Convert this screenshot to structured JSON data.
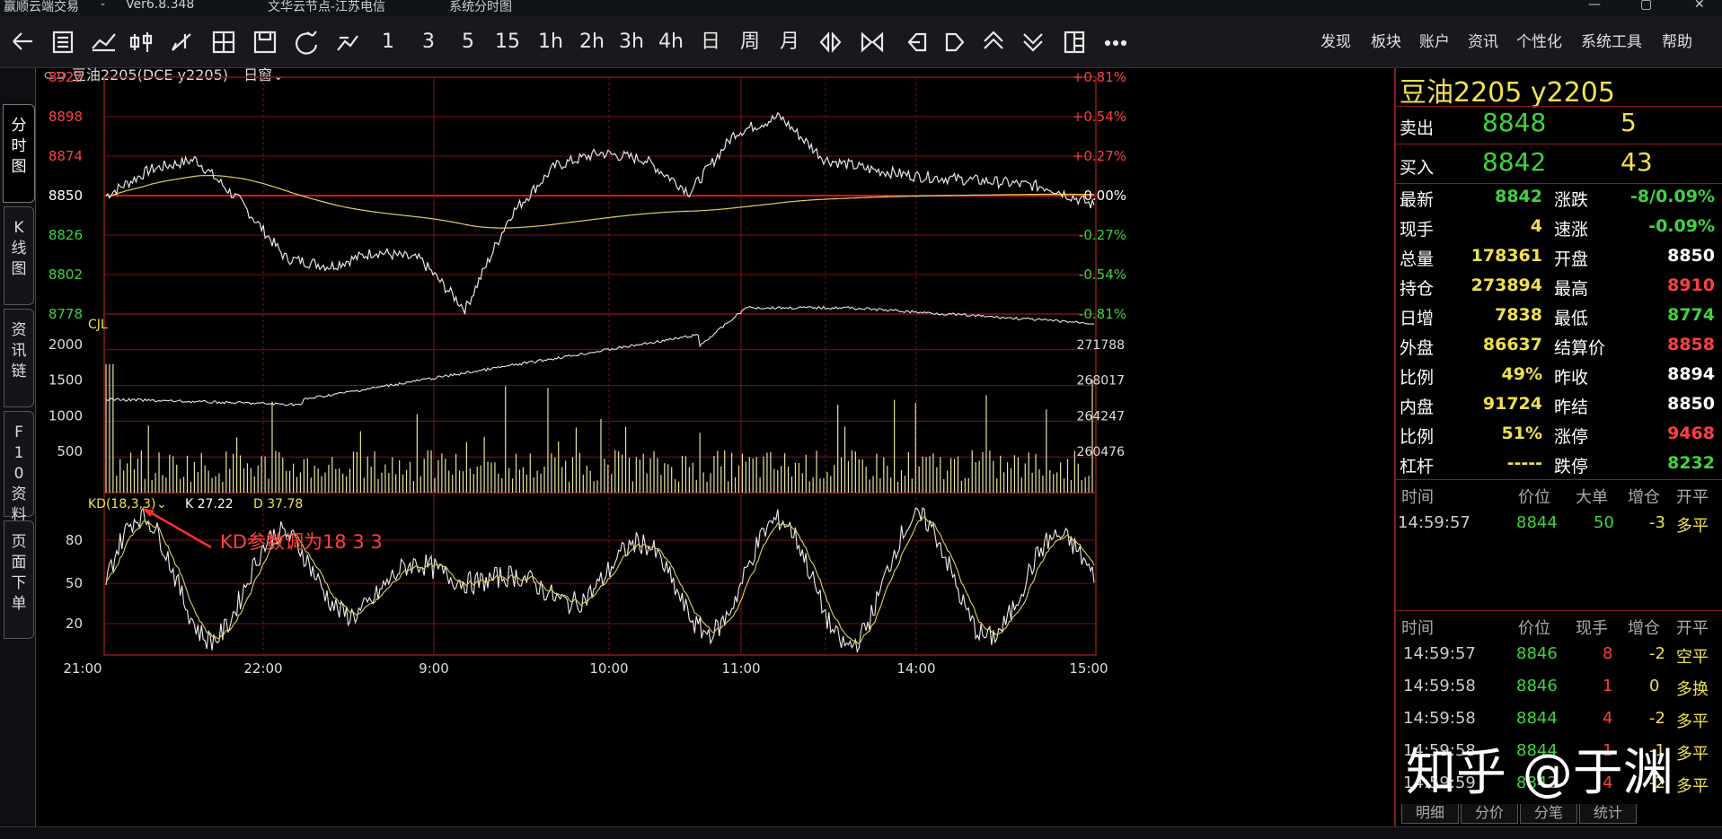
{
  "window": {
    "title_items": [
      "赢顺云端交易",
      "-",
      "Ver6.8.348",
      "文华云节点-江苏电信",
      "系统分时图"
    ]
  },
  "toolbar": {
    "icons": [
      "back-icon",
      "list-icon",
      "line-chart-icon",
      "candlestick-icon",
      "draw-icon",
      "grid-icon",
      "save-icon",
      "refresh-icon",
      "analysis-icon"
    ],
    "periods": [
      "1",
      "3",
      "5",
      "15",
      "1h",
      "2h",
      "3h",
      "4h",
      "日",
      "周",
      "月"
    ],
    "nav_icons": [
      "expand-icon",
      "shrink-icon",
      "arrow-left-icon",
      "arrow-right-icon",
      "arrow-up-icon",
      "arrow-down-icon",
      "layout-icon",
      "more-icon"
    ],
    "menu": [
      "发现",
      "板块",
      "账户",
      "资讯",
      "个性化",
      "系统工具",
      "帮助"
    ]
  },
  "sidebar": {
    "tabs": [
      "分时图",
      "K线图",
      "资讯链",
      "F10资料",
      "页面下单"
    ]
  },
  "chart": {
    "header": {
      "symbol": "豆油2205(DCE y2205)",
      "window": "日窗"
    },
    "price_axis_left": [
      "8922",
      "8898",
      "8874",
      "8850",
      "8826",
      "8802",
      "8778"
    ],
    "price_axis_right": [
      "+0.81%",
      "+0.54%",
      "+0.27%",
      "0.00%",
      "-0.27%",
      "-0.54%",
      "-0.81%"
    ],
    "volume_label": "CJL",
    "volume_axis_left": [
      "2000",
      "1500",
      "1000",
      "500"
    ],
    "volume_axis_right": [
      "271788",
      "268017",
      "264247",
      "260476"
    ],
    "kd_label": "KD(18,3,3)",
    "kd_k": "K 27.22",
    "kd_d": "D 37.78",
    "kd_axis": [
      "80",
      "50",
      "20"
    ],
    "annotation": "KD参数调为18  3  3",
    "time_axis": [
      "21:00",
      "22:00",
      "9:00",
      "10:00",
      "11:00",
      "14:00",
      "15:00"
    ]
  },
  "chart_data": [
    {
      "type": "line",
      "title": "",
      "series_price": "white",
      "series_avg": "yellow",
      "ylim": [
        8778,
        8922
      ],
      "x": [
        "21:00",
        "22:00",
        "9:00",
        "10:00",
        "11:00",
        "14:00",
        "15:00"
      ],
      "values": [
        8850,
        8866,
        8872,
        8846,
        8812,
        8807,
        8816,
        8811,
        8781,
        8838,
        8868,
        8876,
        8872,
        8852,
        8888,
        8898,
        8872,
        8866,
        8862,
        8860,
        8858,
        8855,
        8844
      ]
    },
    {
      "type": "bar",
      "title": "",
      "ylabel": "CJL",
      "ylim": [
        0,
        2500
      ],
      "note": "volume bars with open interest line"
    },
    {
      "type": "line",
      "title": "",
      "series": [
        {
          "name": "K",
          "last": 27.22
        },
        {
          "name": "D",
          "last": 37.78
        }
      ],
      "ylim": [
        0,
        100
      ]
    }
  ],
  "right_panel": {
    "title": "豆油2205  y2205",
    "sell": {
      "label": "卖出",
      "price": "8848",
      "qty": "5"
    },
    "buy": {
      "label": "买入",
      "price": "8842",
      "qty": "43"
    },
    "stats": [
      {
        "l1": "最新",
        "v1": "8842",
        "c1": "#3fd33f",
        "l2": "涨跌",
        "v2": "-8/0.09%",
        "c2": "#3fd33f"
      },
      {
        "l1": "现手",
        "v1": "4",
        "c1": "#f0e050",
        "l2": "速涨",
        "v2": "-0.09%",
        "c2": "#3fd33f"
      },
      {
        "l1": "总量",
        "v1": "178361",
        "c1": "#f0e050",
        "l2": "开盘",
        "v2": "8850",
        "c2": "#ffffff"
      },
      {
        "l1": "持仓",
        "v1": "273894",
        "c1": "#f0e050",
        "l2": "最高",
        "v2": "8910",
        "c2": "#ff4040"
      },
      {
        "l1": "日增",
        "v1": "7838",
        "c1": "#f0e050",
        "l2": "最低",
        "v2": "8774",
        "c2": "#3fd33f"
      },
      {
        "l1": "外盘",
        "v1": "86637",
        "c1": "#f0e050",
        "l2": "结算价",
        "v2": "8858",
        "c2": "#ff4040"
      },
      {
        "l1": "比例",
        "v1": "49%",
        "c1": "#f0e050",
        "l2": "昨收",
        "v2": "8894",
        "c2": "#ffffff"
      },
      {
        "l1": "内盘",
        "v1": "91724",
        "c1": "#f0e050",
        "l2": "昨结",
        "v2": "8850",
        "c2": "#ffffff"
      },
      {
        "l1": "比例",
        "v1": "51%",
        "c1": "#f0e050",
        "l2": "涨停",
        "v2": "9468",
        "c2": "#ff4040"
      },
      {
        "l1": "杠杆",
        "v1": "-----",
        "c1": "#f0e050",
        "l2": "跌停",
        "v2": "8232",
        "c2": "#3fd33f"
      }
    ],
    "big_header": [
      "时间",
      "价位",
      "大单",
      "增仓",
      "开平"
    ],
    "big_rows": [
      {
        "time": "14:59:57",
        "price": "8844",
        "qty": "50",
        "chg": "-3",
        "type": "多平"
      }
    ],
    "tick_header": [
      "时间",
      "价位",
      "现手",
      "增仓",
      "开平"
    ],
    "tick_rows": [
      {
        "time": "14:59:57",
        "price": "8846",
        "pc": "#3fd33f",
        "qty": "8",
        "chg": "-2",
        "type": "空平"
      },
      {
        "time": "14:59:58",
        "price": "8846",
        "pc": "#3fd33f",
        "qty": "1",
        "chg": "0",
        "type": "多换"
      },
      {
        "time": "14:59:58",
        "price": "8844",
        "pc": "#3fd33f",
        "qty": "4",
        "chg": "-2",
        "type": "多平"
      },
      {
        "time": "14:59:58",
        "price": "8844",
        "pc": "#3fd33f",
        "qty": "1",
        "chg": "-1",
        "type": "多平"
      },
      {
        "time": "14:59:59",
        "price": "8842",
        "pc": "#3fd33f",
        "qty": "4",
        "chg": "-2",
        "type": "多平"
      }
    ],
    "bottom_tabs": [
      "明细",
      "分价",
      "分笔",
      "统计"
    ]
  },
  "watermark": "知乎 @于渊"
}
